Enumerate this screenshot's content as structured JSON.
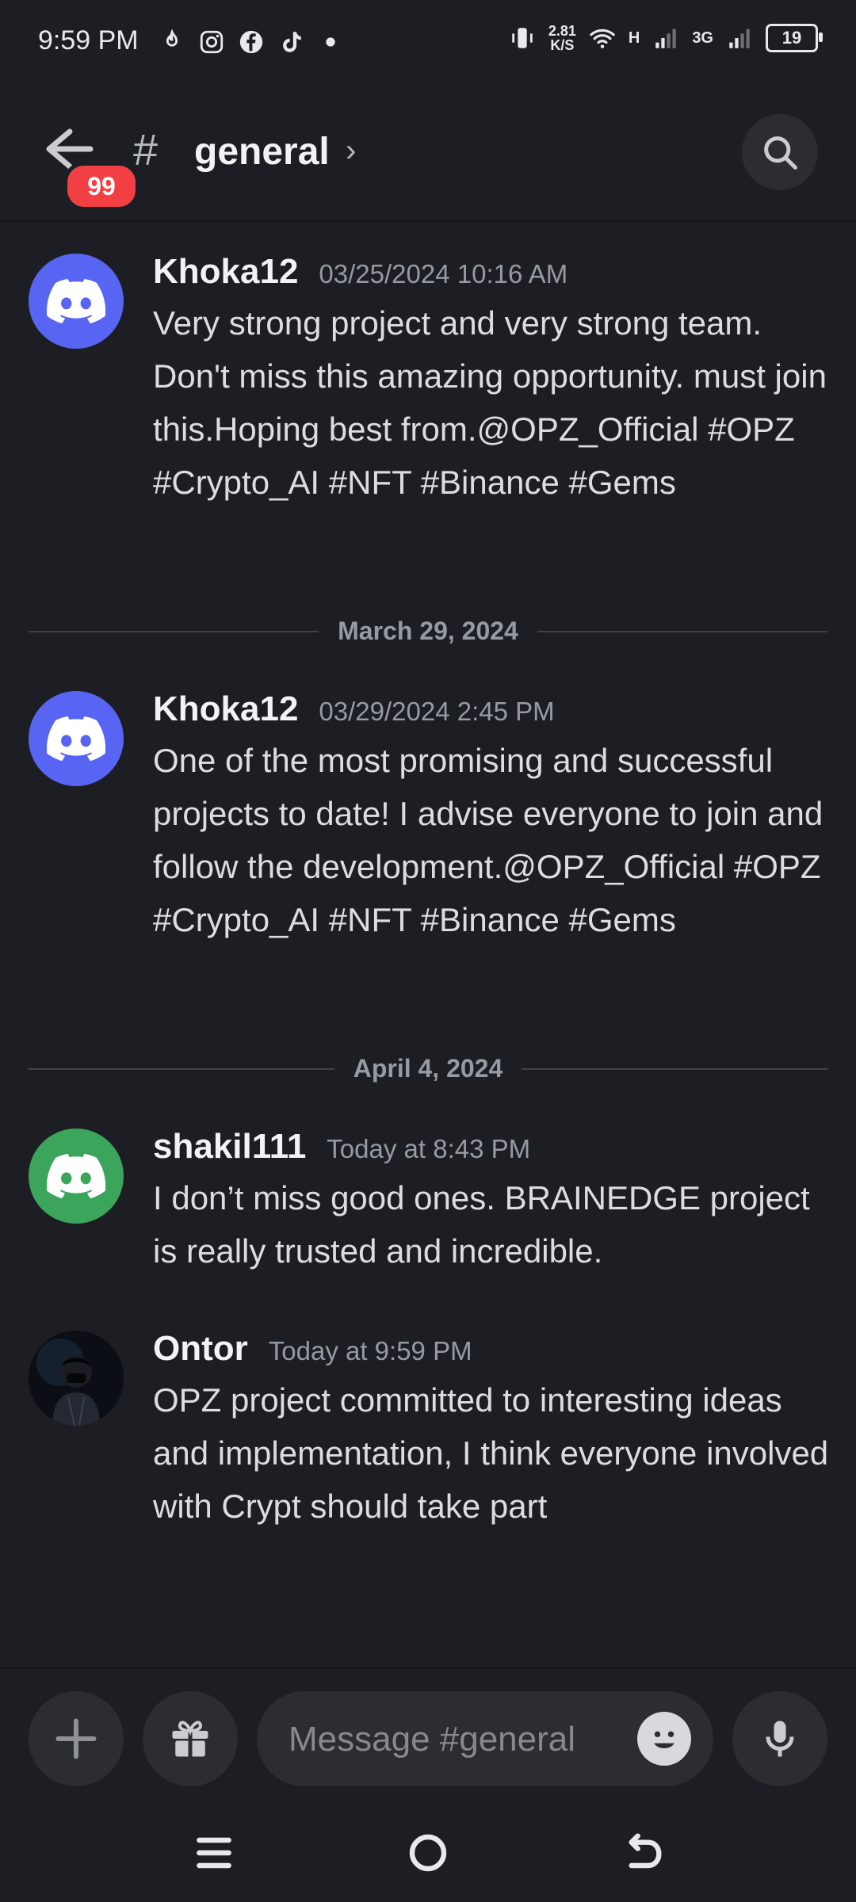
{
  "status_bar": {
    "time": "9:59 PM",
    "speed_value": "2.81",
    "speed_unit": "K/S",
    "signal_1": "H",
    "signal_2": "3G",
    "battery": "19"
  },
  "header": {
    "unread_count": "99",
    "channel_name": "general",
    "chevron": "›"
  },
  "messages": [
    {
      "username": "Khoka12",
      "timestamp": "03/25/2024 10:16 AM",
      "text": "Very strong project and very strong team. Don't miss this amazing opportunity. must join this.Hoping best from.@OPZ_Official #OPZ #Crypto_AI #NFT #Binance #Gems",
      "avatar": "discord-default-blurple"
    },
    {
      "username": "Khoka12",
      "timestamp": "03/29/2024 2:45 PM",
      "text": "One of the most promising and successful projects to date! I advise everyone to join and follow the development.@OPZ_Official #OPZ #Crypto_AI #NFT #Binance #Gems",
      "avatar": "discord-default-blurple"
    },
    {
      "username": "shakil111",
      "timestamp": "Today at 8:43 PM",
      "text": "I don’t miss good ones. BRAINEDGE project is really trusted and incredible.",
      "avatar": "discord-default-green"
    },
    {
      "username": "Ontor",
      "timestamp": "Today at 9:59 PM",
      "text": "OPZ project committed to interesting ideas and implementation, I think everyone involved with Crypt should take part",
      "avatar": "user-photo"
    }
  ],
  "date_dividers": [
    "March 29, 2024",
    "April 4, 2024"
  ],
  "composer": {
    "placeholder": "Message #general"
  },
  "colors": {
    "background": "#1d1e23",
    "blurple": "#5865f2",
    "green": "#3ba55c",
    "badge_red": "#f23f43"
  }
}
